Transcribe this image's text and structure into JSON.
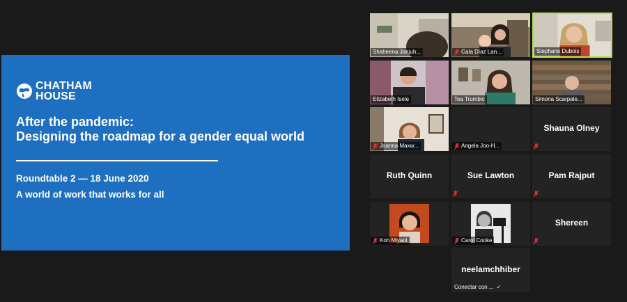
{
  "slide": {
    "logo_line1": "CHATHAM",
    "logo_line2": "HOUSE",
    "title_line1": "After the pandemic:",
    "title_line2": "Designing the roadmap for a gender equal world",
    "roundtable": "Roundtable 2 — 18 June 2020",
    "theme": "A world of work that works for all",
    "background": "#1f6fc0"
  },
  "gallery": {
    "participants": [
      {
        "name": "Shaheena Janjuh...",
        "muted": false,
        "video": true,
        "active": false
      },
      {
        "name": "Gala Díaz Lan...",
        "muted": true,
        "video": true,
        "active": false
      },
      {
        "name": "Stephane Dubois",
        "muted": false,
        "video": true,
        "active": true
      },
      {
        "name": "Elizabeth Isele",
        "muted": false,
        "video": true,
        "active": false
      },
      {
        "name": "Tea Trumbic",
        "muted": false,
        "video": true,
        "active": false
      },
      {
        "name": "Simona Scarpale...",
        "muted": false,
        "video": true,
        "active": false
      },
      {
        "name": "Joanna Maxw...",
        "muted": true,
        "video": true,
        "active": false
      },
      {
        "name": "Angela Joo-H...",
        "muted": true,
        "video": false,
        "active": false
      },
      {
        "name": "Shauna Olney",
        "muted": true,
        "video": false,
        "active": false
      },
      {
        "name": "Ruth Quinn",
        "muted": false,
        "video": false,
        "active": false
      },
      {
        "name": "Sue Lawton",
        "muted": true,
        "video": false,
        "active": false
      },
      {
        "name": "Pam Rajput",
        "muted": true,
        "video": false,
        "active": false
      },
      {
        "name": "Koh Miyaoi",
        "muted": true,
        "video": false,
        "active": false
      },
      {
        "name": "Carol Cooke",
        "muted": true,
        "video": false,
        "active": false
      },
      {
        "name": "Shereen",
        "muted": true,
        "video": false,
        "active": false
      },
      {
        "name": "neelamchhiber",
        "muted": false,
        "video": false,
        "active": false
      }
    ],
    "connecting_label": "Conectar con ...",
    "active_color": "#b4e04a",
    "muted_color": "#e0323a"
  }
}
